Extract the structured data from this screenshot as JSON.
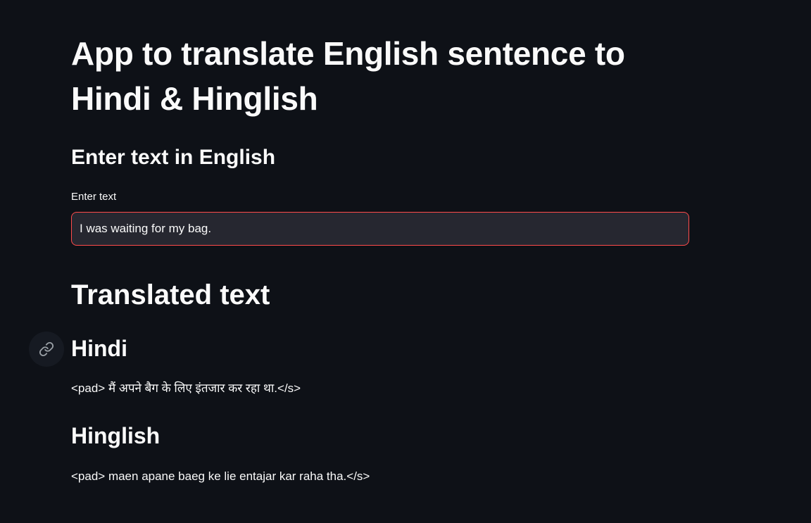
{
  "app": {
    "title": "App to translate English sentence to Hindi & Hinglish"
  },
  "input_section": {
    "subheader": "Enter text in English",
    "label": "Enter text",
    "value": "I was waiting for my bag."
  },
  "output_section": {
    "header": "Translated text",
    "hindi": {
      "subheader": "Hindi",
      "text": "<pad> मैं अपने बैग के लिए इंतजार कर रहा था.</s>"
    },
    "hinglish": {
      "subheader": "Hinglish",
      "text": "<pad> maen apane baeg ke lie entajar kar raha tha.</s>"
    }
  },
  "icons": {
    "anchor": "link-icon"
  },
  "colors": {
    "background": "#0e1117",
    "text": "#fafafa",
    "input_bg": "#262730",
    "input_border_focus": "#ff4b4b"
  }
}
